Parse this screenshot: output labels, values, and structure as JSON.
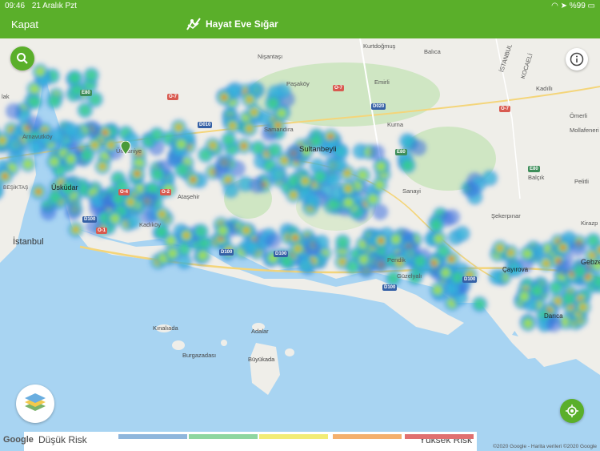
{
  "status": {
    "time": "09:46",
    "date": "21 Aralık Pzt",
    "battery": "%99"
  },
  "header": {
    "close_label": "Kapat",
    "app_title": "Hayat Eve Sığar"
  },
  "places": {
    "nisantasi": "Nişantaşı",
    "kurtdogmus": "Kurtdoğmuş",
    "basiska": "Balıca",
    "istanbul_road": "İSTANBUL",
    "kocaeli": "KOCAELİ",
    "emirli": "Emirli",
    "pasakoy": "Paşaköy",
    "kadilli": "Kadıllı",
    "kurna": "Kurna",
    "samandira": "Samandıra",
    "sultanbeyli": "Sultanbeyli",
    "omerli": "Ömerli",
    "mollafeneri": "Mollafeneri",
    "balcik": "Balçık",
    "pelitli": "Pelitli",
    "sanayi": "Sanayi",
    "umraniye": "Ümraniye",
    "uskudar": "Üsküdar",
    "besiktas": "BEŞİKTAŞ",
    "arnavutkoy": "Arnavutköy",
    "atasehir": "Ataşehir",
    "kadikoy": "Kadıköy",
    "istanbul": "İstanbul",
    "sekerpinar": "Şekerpınar",
    "kirazpinar": "Kirazp",
    "cayirova": "Çayırova",
    "gebze": "Gebze",
    "pendik": "Pendik",
    "guzelyali": "Güzelyalı",
    "darica": "Darıca",
    "kinaliada": "Kınalıada",
    "adalar": "Adalar",
    "burgazadasi": "Burgazadası",
    "buyukada": "Büyükada",
    "balat": "lak"
  },
  "roads": [
    "O-7",
    "O-7",
    "D020",
    "D010",
    "E80",
    "E80",
    "O-4",
    "O-2",
    "D100",
    "O-1",
    "D100",
    "D100",
    "D100",
    "D100",
    "O-7",
    "E80"
  ],
  "legend": {
    "low_label": "Düşük Risk",
    "high_label": "Yüksek Risk",
    "colors": [
      "#8fb6dc",
      "#8fd6a0",
      "#f2ec77",
      "#f4b06e",
      "#e07070"
    ]
  },
  "attribution": {
    "logo": "Google",
    "copyright": "©2020 Google - Harita verileri ©2020 Google"
  },
  "icons": {
    "search": "search-icon",
    "info": "info-icon",
    "layers": "map-layers-icon",
    "locate": "locate-icon"
  }
}
